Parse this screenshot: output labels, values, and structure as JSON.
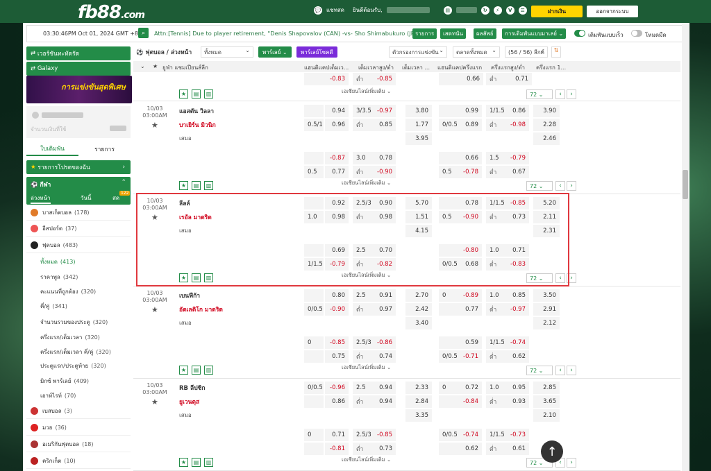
{
  "header": {
    "logo": "fb88",
    "logo_suffix": ".com",
    "chat_label": "แชทสด",
    "welcome": "ยินดีต้อนรับ,",
    "deposit": "ฝากเงิน",
    "logout": "ออกจากระบบ"
  },
  "ticker": {
    "time": "03:30:46PM Oct 01, 2024 GMT +8",
    "text": "Attn:[Tennis] Due to player retirement, \"Denis Shapovalov (CAN) -vs- Sho Shimabukuro (JPN)\"",
    "btn1": "รายการ",
    "btn2": "เสดทนัน",
    "btn3": "ผลลัพธ์",
    "btn4": "การเดิมพันแบบมาเลย์ ⌄",
    "toggle1": "เดิมพันแบบเร็ว",
    "toggle2": "โหมดมืด"
  },
  "sidebar": {
    "virtual": "เวอร์ชันทะทัดรัด",
    "galaxy": "Galaxy",
    "banner": "การแข่งขันสุดพิเศษ",
    "balance_label": "จำนวนเงินที่ใช้",
    "tab1": "ใบเดิมพัน",
    "tab2": "รายการ",
    "favorites": "รายการโปรดของฉัน",
    "sports_label": "กีฬา",
    "sub1": "ล่วงหน้า",
    "sub2": "วันนี้",
    "sub3": "สด",
    "live_badge": "122",
    "items": [
      {
        "label": "บาสเก็ตบอล",
        "count": "(178)"
      },
      {
        "label": "อีสปอร์ต",
        "count": "(37)"
      },
      {
        "label": "ฟุตบอล",
        "count": "(483)"
      }
    ],
    "subitems": [
      {
        "label": "ทั้งหมด",
        "count": "(413)"
      },
      {
        "label": "ราคาพูล",
        "count": "(342)"
      },
      {
        "label": "คะแนนที่ถูกต้อง",
        "count": "(320)"
      },
      {
        "label": "คี่/คู่",
        "count": "(341)"
      },
      {
        "label": "จำนวนรวมของประตู",
        "count": "(320)"
      },
      {
        "label": "ครึ่งแรก/เต็มเวลา",
        "count": "(320)"
      },
      {
        "label": "ครึ่งแรก/เต็มเวลา คี่/คู่",
        "count": "(320)"
      },
      {
        "label": "ประตูแรก/ประตูท้าย",
        "count": "(320)"
      },
      {
        "label": "มิกซ์ พาร์เลย์",
        "count": "(409)"
      },
      {
        "label": "เอาท์ไรท์",
        "count": "(70)"
      }
    ],
    "items2": [
      {
        "label": "เบสบอล",
        "count": "(3)"
      },
      {
        "label": "มวย",
        "count": "(36)"
      },
      {
        "label": "อเมริกันฟุตบอล",
        "count": "(18)"
      },
      {
        "label": "คริกเก็ต",
        "count": "(10)"
      }
    ]
  },
  "main": {
    "title": "ฟุตบอล / ล่วงหน้า",
    "filter": "ทั้งหมด",
    "parlay": "พาร์เลย์",
    "parlay_plus": "พาร์เลย์โซคดี",
    "league_filter": "ตัวกรองการแข่งขัน",
    "market_filter": "ตลาดทั้งหมด",
    "league_count": "(56 / 56) ลีกค์",
    "col_league": "ยูฟ่า แชมเปียนส์ลีก",
    "col1": "แฮนดิแคปเต็มเว...",
    "col2": "เต็มเวลาสูง/ต่ำ",
    "col3": "เต็มเวลา ...",
    "col4": "แฮนดิแคปครึ่งแรก",
    "col5": "ครึ่งแรกสูง/ต่ำ",
    "col6": "ครึ่งแรก 1...",
    "more": "เอเชียนไลน์เพิ่มเติม ⌄",
    "page": "72",
    "top": {
      "r1": [
        "-0.83",
        "ต่ำ",
        "-0.85",
        "0.66",
        "ต่ำ",
        "0.71"
      ]
    },
    "matches": [
      {
        "date": "10/03",
        "time": "03:00AM",
        "home": "แอสตัน วิลลา",
        "away": "บาเยิร์น มิวนิก",
        "draw": "เสมอ",
        "a1": [
          "",
          "0.94",
          "3/3.5",
          "-0.97",
          "3.80",
          "",
          "0.99",
          "1/1.5",
          "0.86",
          "3.90"
        ],
        "a2": [
          "0.5/1",
          "0.96",
          "ต่ำ",
          "0.85",
          "1.77",
          "0/0.5",
          "0.89",
          "ต่ำ",
          "-0.98",
          "2.28"
        ],
        "a3": [
          "3.95",
          "2.46"
        ],
        "b1": [
          "",
          "-0.87",
          "3.0",
          "0.78",
          "",
          "0.66",
          "1.5",
          "-0.79"
        ],
        "b2": [
          "0.5",
          "0.77",
          "ต่ำ",
          "-0.90",
          "0.5",
          "-0.78",
          "ต่ำ",
          "0.67"
        ]
      },
      {
        "date": "10/03",
        "time": "03:00AM",
        "home": "ลีลล์",
        "away": "เรอัล มาดริด",
        "draw": "เสมอ",
        "a1": [
          "",
          "0.92",
          "2.5/3",
          "0.90",
          "5.70",
          "",
          "0.78",
          "1/1.5",
          "-0.85",
          "5.20"
        ],
        "a2": [
          "1.0",
          "0.98",
          "ต่ำ",
          "0.98",
          "1.51",
          "0.5",
          "-0.90",
          "ต่ำ",
          "0.73",
          "2.11"
        ],
        "a3": [
          "4.15",
          "2.31"
        ],
        "b1": [
          "",
          "0.69",
          "2.5",
          "0.70",
          "",
          "-0.80",
          "1.0",
          "0.71"
        ],
        "b2": [
          "1/1.5",
          "-0.79",
          "ต่ำ",
          "-0.82",
          "0/0.5",
          "0.68",
          "ต่ำ",
          "-0.83"
        ]
      },
      {
        "date": "10/03",
        "time": "03:00AM",
        "home": "เบนฟีก้า",
        "away": "อัตเลติโก มาดริด",
        "draw": "เสมอ",
        "a1": [
          "",
          "0.80",
          "2.5",
          "0.91",
          "2.70",
          "0",
          "-0.89",
          "1.0",
          "0.85",
          "3.50"
        ],
        "a2": [
          "0/0.5",
          "-0.90",
          "ต่ำ",
          "0.97",
          "2.42",
          "",
          "0.77",
          "ต่ำ",
          "-0.97",
          "2.91"
        ],
        "a3": [
          "3.40",
          "2.12"
        ],
        "b1": [
          "0",
          "-0.85",
          "2.5/3",
          "-0.86",
          "",
          "0.59",
          "1/1.5",
          "-0.74"
        ],
        "b2": [
          "",
          "0.75",
          "ต่ำ",
          "0.74",
          "0/0.5",
          "-0.71",
          "ต่ำ",
          "0.62"
        ]
      },
      {
        "date": "10/03",
        "time": "03:00AM",
        "home": "RB ลีปซิก",
        "away": "ยูเวนตุส",
        "draw": "เสมอ",
        "a1": [
          "0/0.5",
          "-0.96",
          "2.5",
          "0.94",
          "2.33",
          "0",
          "0.72",
          "1.0",
          "0.95",
          "2.85"
        ],
        "a2": [
          "",
          "0.86",
          "ต่ำ",
          "0.94",
          "2.84",
          "",
          "-0.84",
          "ต่ำ",
          "0.93",
          "3.65"
        ],
        "a3": [
          "3.35",
          "2.10"
        ],
        "b1": [
          "0",
          "0.71",
          "2.5/3",
          "-0.85",
          "0/0.5",
          "-0.74",
          "1/1.5",
          "-0.73"
        ],
        "b2": [
          "",
          "-0.81",
          "ต่ำ",
          "0.73",
          "",
          "0.62",
          "ต่ำ",
          "0.61"
        ]
      }
    ]
  },
  "colors": {
    "green": "#238c48",
    "red": "#d0021b",
    "highlight": "#e0383e"
  }
}
